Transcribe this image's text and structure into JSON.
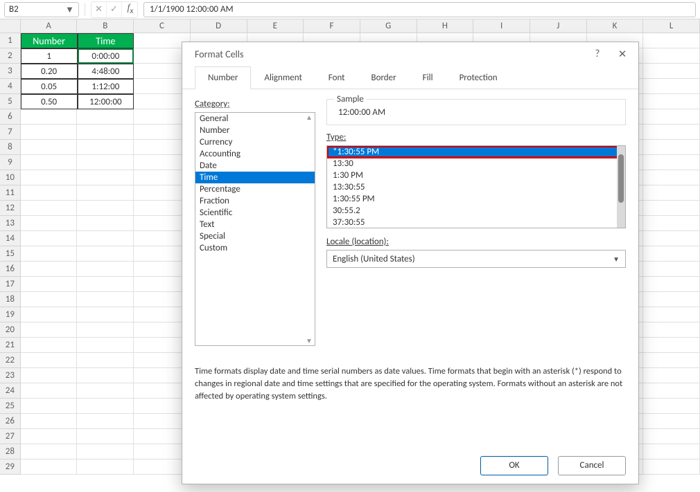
{
  "formula_bar": {
    "namebox": "B2",
    "value": "1/1/1900  12:00:00 AM"
  },
  "columns": [
    "A",
    "B",
    "C",
    "D",
    "E",
    "F",
    "G",
    "H",
    "I",
    "J",
    "K",
    "L"
  ],
  "rows": [
    1,
    2,
    3,
    4,
    5,
    6,
    7,
    8,
    9,
    10,
    11,
    12,
    13,
    14,
    15,
    16,
    17,
    18,
    19,
    20,
    21,
    22,
    23,
    24,
    25,
    26,
    27,
    28,
    29
  ],
  "table": {
    "headers": [
      "Number",
      "Time"
    ],
    "data": [
      [
        "1",
        "0:00:00"
      ],
      [
        "0.20",
        "4:48:00"
      ],
      [
        "0.05",
        "1:12:00"
      ],
      [
        "0.50",
        "12:00:00"
      ]
    ]
  },
  "active_cell": "B2",
  "dialog": {
    "title": "Format Cells",
    "tabs": [
      "Number",
      "Alignment",
      "Font",
      "Border",
      "Fill",
      "Protection"
    ],
    "active_tab": "Number",
    "category_label": "Category:",
    "categories": [
      "General",
      "Number",
      "Currency",
      "Accounting",
      "Date",
      "Time",
      "Percentage",
      "Fraction",
      "Scientific",
      "Text",
      "Special",
      "Custom"
    ],
    "selected_category": "Time",
    "sample_label": "Sample",
    "sample_value": "12:00:00 AM",
    "type_label": "Type:",
    "types": [
      "*1:30:55 PM",
      "13:30",
      "1:30 PM",
      "13:30:55",
      "1:30:55 PM",
      "30:55.2",
      "37:30:55"
    ],
    "selected_type": "*1:30:55 PM",
    "locale_label": "Locale (location):",
    "locale_value": "English (United States)",
    "description": "Time formats display date and time serial numbers as date values.  Time formats that begin with an asterisk (*) respond to changes in regional date and time settings that are specified for the operating system.  Formats without an asterisk are not affected by operating system settings.",
    "ok": "OK",
    "cancel": "Cancel"
  }
}
